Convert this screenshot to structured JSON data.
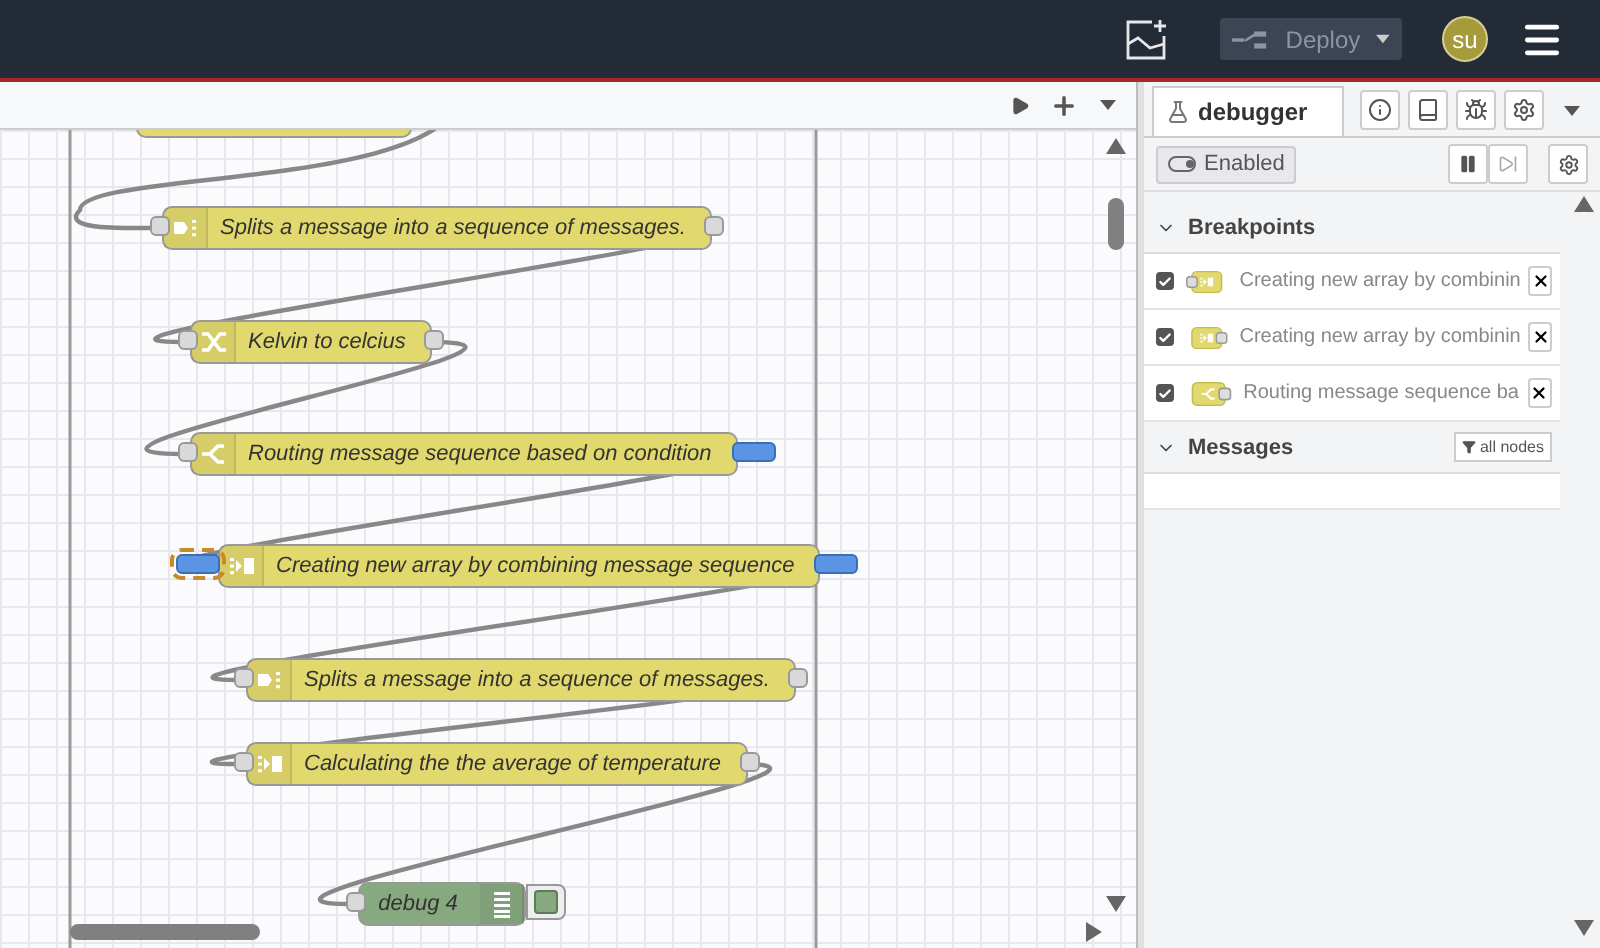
{
  "header": {
    "deploy": "Deploy",
    "avatar": "su"
  },
  "workspace": {
    "nodes": [
      {
        "label": "Splits a message into a sequence of messages.",
        "kind": "split",
        "in_break": false,
        "out_break": false,
        "paused": false
      },
      {
        "label": "Kelvin to celcius",
        "kind": "change",
        "in_break": false,
        "out_break": false,
        "paused": false
      },
      {
        "label": "Routing message sequence based on condition",
        "kind": "switch",
        "in_break": false,
        "out_break": true,
        "paused": false
      },
      {
        "label": "Creating new array by combining message sequence",
        "kind": "join",
        "in_break": true,
        "out_break": true,
        "paused": true
      },
      {
        "label": "Splits a message into a sequence of messages.",
        "kind": "split",
        "in_break": false,
        "out_break": false,
        "paused": false
      },
      {
        "label": "Calculating the the average of temperature",
        "kind": "join",
        "in_break": false,
        "out_break": false,
        "paused": false
      },
      {
        "label": "debug 4",
        "kind": "debug",
        "in_break": false,
        "out_break": false,
        "paused": false
      }
    ]
  },
  "sidebar": {
    "tab": "debugger",
    "enabled": {
      "label": "Enabled",
      "on": true
    },
    "breakpoints": {
      "title": "Breakpoints",
      "expanded": true,
      "items": [
        {
          "label": "Creating new array by combinin",
          "kind": "join",
          "on_input": true,
          "checked": true
        },
        {
          "label": "Creating new array by combinin",
          "kind": "join",
          "on_input": false,
          "checked": true
        },
        {
          "label": "Routing message sequence ba",
          "kind": "switch",
          "on_input": false,
          "checked": true
        }
      ]
    },
    "messages": {
      "title": "Messages",
      "expanded": true,
      "filter": "all nodes"
    }
  }
}
